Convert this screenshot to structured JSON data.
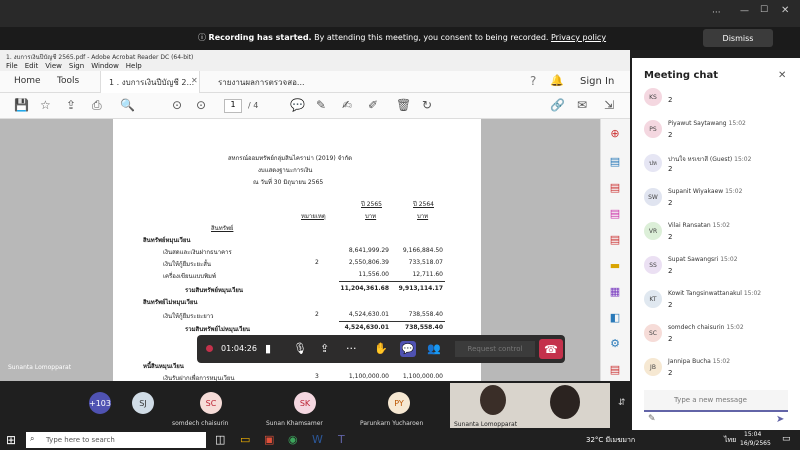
{
  "window": {
    "title": "Recording has started.",
    "banner_text": " By attending this meeting, you consent to being recorded.",
    "privacy_link": "Privacy policy",
    "dismiss_label": "Dismiss"
  },
  "acrobat": {
    "title": "1. งบการเงินปีบัญชี 2565.pdf - Adobe Acrobat Reader DC (64-bit)",
    "menu": [
      "File",
      "Edit",
      "View",
      "Sign",
      "Window",
      "Help"
    ],
    "home_tab": "Home",
    "tools_tab": "Tools",
    "doc_tab1": "1 . งบการเงินปีบัญชี 2...",
    "doc_tab2": "รายงานผลการตรวจสอ...",
    "sign_in": "Sign In",
    "page_current": "1",
    "page_total": "/  4"
  },
  "document": {
    "heading1": "สหกรณ์ออมทรัพย์กลุ่มสินไคราม่า (2019) จำกัด",
    "heading2": "งบแสดงฐานะการเงิน",
    "heading3": "ณ วันที่ 30 มิถุนายน 2565",
    "col_year1": "ปี 2565",
    "col_year2": "ปี 2564",
    "col_note": "หมายเหตุ",
    "col_unit": "บาท",
    "section_assets": "สินทรัพย์",
    "current_assets": "สินทรัพย์หมุนเวียน",
    "rows": [
      {
        "label": "เงินสดและเงินฝากธนาคาร",
        "note": "",
        "v1": "8,641,999.29",
        "v2": "9,166,884.50"
      },
      {
        "label": "เงินให้กู้ยืมระยะสั้น",
        "note": "2",
        "v1": "2,550,806.39",
        "v2": "733,518.07"
      },
      {
        "label": "เครื่องเขียนแบบพิมพ์",
        "note": "",
        "v1": "11,556.00",
        "v2": "12,711.60"
      }
    ],
    "total_current": {
      "label": "รวมสินทรัพย์หมุนเวียน",
      "v1": "11,204,361.68",
      "v2": "9,913,114.17"
    },
    "noncurrent": "สินทรัพย์ไม่หมุนเวียน",
    "row_nc": {
      "label": "เงินให้กู้ยืมระยะยาว",
      "note": "2",
      "v1": "4,524,630.01",
      "v2": "738,558.40"
    },
    "total_nc": {
      "label": "รวมสินทรัพย์ไม่หมุนเวียน",
      "v1": "4,524,630.01",
      "v2": "738,558.40"
    },
    "liab": "หนี้สินหมุนเวียน",
    "row_l": {
      "label": "เงินรับฝากเพื่อการหมุนเวียน",
      "note": "3",
      "v1": "1,100,000.00",
      "v2": "1,100,000.00"
    }
  },
  "chat": {
    "title": "Meeting chat",
    "messages": [
      {
        "init": "KS",
        "name": "",
        "time": "",
        "text": "2"
      },
      {
        "init": "PS",
        "name": "Piyawut Saytawang",
        "time": "15:02",
        "text": "2"
      },
      {
        "init": "ปห",
        "name": "ปานใจ หรเขาสี (Guest)",
        "time": "15:02",
        "text": "2"
      },
      {
        "init": "SW",
        "name": "Supanit Wiyakaew",
        "time": "15:02",
        "text": "2"
      },
      {
        "init": "VR",
        "name": "Vilai Ransatan",
        "time": "15:02",
        "text": "2"
      },
      {
        "init": "SS",
        "name": "Supat Sawangsri",
        "time": "15:02",
        "text": "2"
      },
      {
        "init": "KT",
        "name": "Kowit Tangsinwattanakul",
        "time": "15:02",
        "text": "2"
      },
      {
        "init": "SC",
        "name": "somdech chaisurin",
        "time": "15:02",
        "text": "2"
      },
      {
        "init": "JB",
        "name": "Jannipa Bucha",
        "time": "15:02",
        "text": "2"
      }
    ],
    "placeholder": "Type a new message"
  },
  "meeting": {
    "timer": "01:04:26",
    "request_control": "Request control",
    "presenter": "Sunanta Lomopparat",
    "count": "+103",
    "participants": [
      {
        "init": "SJ",
        "name": ""
      },
      {
        "init": "SC",
        "name": "somdech chaisurin"
      },
      {
        "init": "SK",
        "name": "Sunan Khamsamer"
      },
      {
        "init": "PY",
        "name": "Parunkarn Yucharoen"
      }
    ],
    "video_name": "Sunanta Lomopparat"
  },
  "taskbar": {
    "search": "Type here to search",
    "temp": "32°C  มีเมฆมาก",
    "lang": "ไทย",
    "time": "15:04",
    "date": "16/9/2565"
  },
  "colors": {
    "accent": "#6264a7",
    "hangup": "#c4314b"
  }
}
